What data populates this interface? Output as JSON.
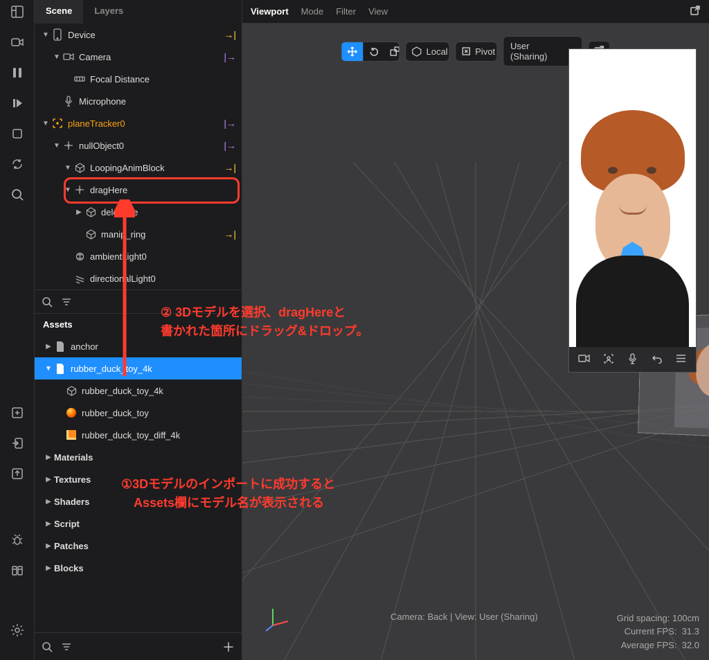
{
  "tabs": {
    "scene": "Scene",
    "layers": "Layers"
  },
  "scene_tree": {
    "device": "Device",
    "camera": "Camera",
    "focal": "Focal Distance",
    "microphone": "Microphone",
    "planeTracker": "planeTracker0",
    "nullObject": "nullObject0",
    "loopingAnim": "LoopingAnimBlock",
    "dragHere": "dragHere",
    "deleteMe": "deleteMe",
    "manipRing": "manip_ring",
    "ambient": "ambientLight0",
    "directional": "directionalLight0"
  },
  "assets_header": "Assets",
  "assets": {
    "anchor": "anchor",
    "rubber_duck_folder": "rubber_duck_toy_4k",
    "rubber_duck_mesh": "rubber_duck_toy_4k",
    "rubber_duck_mat": "rubber_duck_toy",
    "rubber_duck_tex": "rubber_duck_toy_diff_4k",
    "materials": "Materials",
    "textures": "Textures",
    "shaders": "Shaders",
    "script": "Script",
    "patches": "Patches",
    "blocks": "Blocks"
  },
  "viewport": {
    "title": "Viewport",
    "menu_mode": "Mode",
    "menu_filter": "Filter",
    "menu_view": "View",
    "local": "Local",
    "pivot": "Pivot",
    "user_select": "User (Sharing)"
  },
  "status": {
    "camera_view": "Camera: Back | View: User (Sharing)",
    "grid_spacing": "Grid spacing:  100cm",
    "current_fps_label": "Current FPS:",
    "current_fps": "31.3",
    "avg_fps_label": "Average FPS:",
    "avg_fps": "32.0"
  },
  "annotations": {
    "annot2_l1": "② 3Dモデルを選択、dragHereと",
    "annot2_l2": "書かれた箇所にドラッグ&ドロップ。",
    "annot1_l1": "①3Dモデルのインポートに成功すると",
    "annot1_l2": "Assets欄にモデル名が表示される"
  }
}
